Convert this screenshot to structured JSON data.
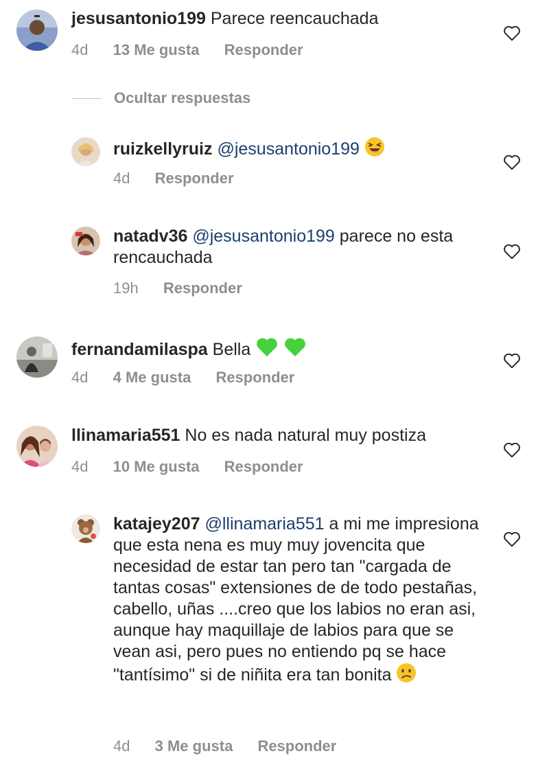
{
  "comments": [
    {
      "username": "jesusantonio199",
      "text": "Parece reencauchada",
      "time": "4d",
      "likes": "13 Me gusta",
      "reply": "Responder"
    },
    {
      "hide_replies": "Ocultar respuestas"
    },
    {
      "username": "ruizkellyruiz",
      "mention": "@jesusantonio199",
      "emoji": "laughing-face",
      "time": "4d",
      "reply": "Responder"
    },
    {
      "username": "natadv36",
      "mention": "@jesusantonio199",
      "text": "parece no esta rencauchada",
      "time": "19h",
      "reply": "Responder"
    },
    {
      "username": "fernandamilaspa",
      "text": "Bella",
      "emoji": "green-heart x2",
      "time": "4d",
      "likes": "4 Me gusta",
      "reply": "Responder"
    },
    {
      "username": "llinamaria551",
      "text": "No es nada natural muy postiza",
      "time": "4d",
      "likes": "10 Me gusta",
      "reply": "Responder"
    },
    {
      "username": "katajey207",
      "mention": "@llinamaria551",
      "text": "a mi me impresiona que esta nena es muy muy jovencita que necesidad de estar tan pero tan \"cargada de tantas cosas\" extensiones de de todo pestañas, cabello, uñas ....creo que los labios no eran asi, aunque hay maquillaje de labios para que se vean asi, pero pues no entiendo pq se hace \"tantísimo\" si de niñita era tan bonita",
      "emoji": "confused-face",
      "time": "4d",
      "likes": "3 Me gusta",
      "reply": "Responder"
    }
  ],
  "colors": {
    "text": "#262626",
    "muted": "#8e8e8e",
    "mention": "#1a3f6e",
    "heart_emoji": "#47d13c"
  }
}
